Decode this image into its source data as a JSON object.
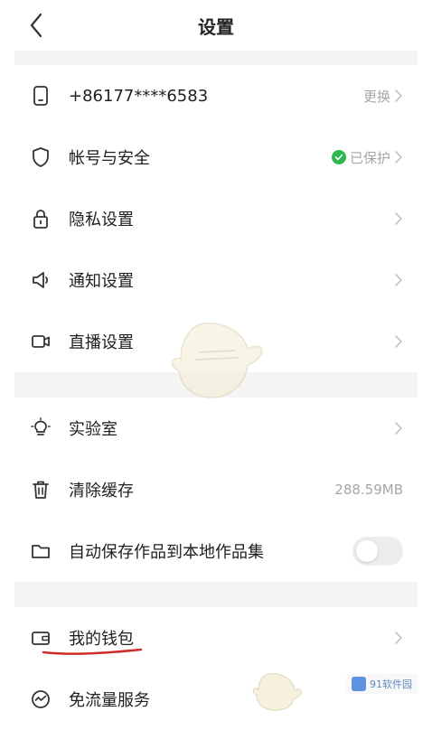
{
  "header": {
    "title": "设置"
  },
  "account": {
    "phone": {
      "label": "+86177****6583",
      "action": "更换"
    },
    "security": {
      "label": "帐号与安全",
      "status": "已保护"
    },
    "privacy": {
      "label": "隐私设置"
    },
    "notify": {
      "label": "通知设置"
    },
    "live": {
      "label": "直播设置"
    }
  },
  "tools": {
    "lab": {
      "label": "实验室"
    },
    "cache": {
      "label": "清除缓存",
      "value": "288.59MB"
    },
    "autosave": {
      "label": "自动保存作品到本地作品集",
      "enabled": false
    }
  },
  "wallet": {
    "wallet": {
      "label": "我的钱包"
    },
    "free_data": {
      "label": "免流量服务"
    }
  },
  "watermark": {
    "badge": "91软件园"
  },
  "colors": {
    "green": "#2db84d",
    "red_mark": "#d12a2a",
    "gray_text": "#a6a6a6"
  }
}
